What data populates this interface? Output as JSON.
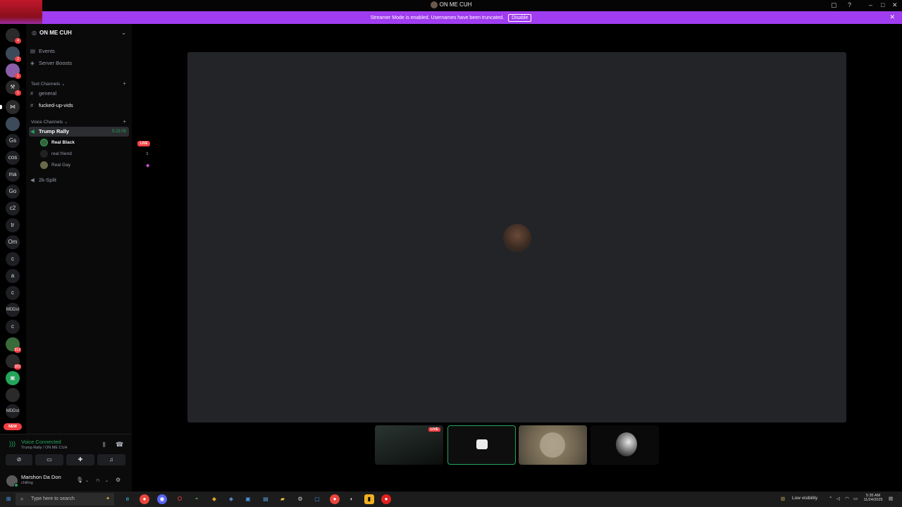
{
  "window": {
    "title": "ON ME CUH"
  },
  "banner": {
    "message": "Streamer Mode is enabled. Usernames have been truncated.",
    "disable_label": "Disable"
  },
  "rail": {
    "text_servers": [
      "Gs",
      "cos",
      "ma",
      "Go",
      "c2",
      "tr",
      "Om",
      "c",
      "a",
      "c",
      "MDDst",
      "c",
      "MDDst"
    ],
    "badges": [
      "4",
      "2",
      "1",
      "1",
      "912",
      "303"
    ],
    "new_label": "NEW"
  },
  "sidebar": {
    "server_name": "ON ME CUH",
    "events_label": "Events",
    "boosts_label": "Server Boosts",
    "text_category": "Text Channels",
    "text_channels": [
      "general",
      "fucked-up-vids"
    ],
    "voice_category": "Voice Channels",
    "voice_channel": {
      "name": "Trump Rally",
      "timer": "5:23:05"
    },
    "voice_users": [
      {
        "name": "Real Black",
        "live": "LIVE"
      },
      {
        "name": "real friend"
      },
      {
        "name": "Real Gay"
      }
    ],
    "other_voice": "2k-Split"
  },
  "voice_panel": {
    "status": "Voice Connected",
    "location": "Trump Rally / ON ME CUH",
    "username": "Marshon Da Don",
    "user_status": "chilling"
  },
  "tiles": {
    "live_label": "LIVE"
  },
  "taskbar": {
    "search_placeholder": "Type here to search",
    "visibility": "Low visibility",
    "time": "5:35 AM",
    "date": "11/24/2025"
  },
  "colors": {
    "accent": "#a03df0",
    "live": "#f23f43",
    "connected": "#23a55a"
  }
}
